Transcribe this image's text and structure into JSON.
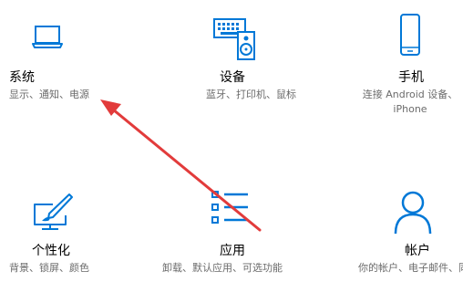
{
  "accent_color": "#0078d7",
  "annotation_arrow_color": "#e23b3b",
  "tiles": [
    {
      "title": "系统",
      "description": "显示、通知、电源",
      "icon": "laptop-icon"
    },
    {
      "title": "设备",
      "description": "蓝牙、打印机、鼠标",
      "icon": "keyboard-speaker-icon"
    },
    {
      "title": "手机",
      "description": "连接 Android 设备、iPhone",
      "icon": "phone-icon"
    },
    {
      "title": "个性化",
      "description": "背景、锁屏、颜色",
      "icon": "paint-monitor-icon"
    },
    {
      "title": "应用",
      "description": "卸载、默认应用、可选功能",
      "icon": "apps-list-icon"
    },
    {
      "title": "帐户",
      "description": "你的帐户、电子邮件、同步",
      "icon": "person-icon"
    }
  ]
}
